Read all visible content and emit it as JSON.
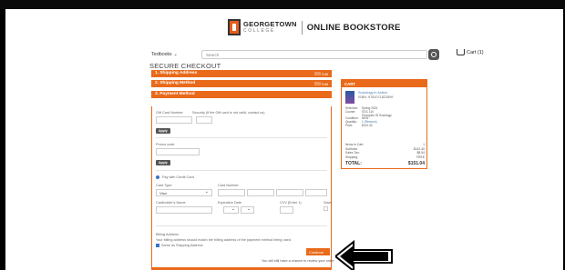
{
  "browser": {
    "left": "",
    "right": ""
  },
  "brand": {
    "name": "GEORGETOWN",
    "subname": "COLLEGE",
    "store": "ONLINE BOOKSTORE"
  },
  "nav": {
    "textbooks": "Textbooks",
    "search_placeholder": "Search",
    "cart": "Cart (1)"
  },
  "page_title": "SECURE CHECKOUT",
  "steps": [
    {
      "label": "1. Shipping Address",
      "edit": "Edit"
    },
    {
      "label": "2. Shipping Method",
      "edit": "Edit"
    },
    {
      "label": "3. Payment Method"
    }
  ],
  "payment": {
    "gift_card_label": "Gift Card Number",
    "gift_card_note": "Security (If the Gift card is not valid, contact us)",
    "apply1": "Apply",
    "promo_label": "Promo code",
    "apply2": "Apply",
    "pay_with": "Pay with Credit Card",
    "card_type_label": "Card Type",
    "card_type_value": "Visa",
    "card_number_label": "Card Number",
    "cardholder_label": "Cardholder's Name",
    "exp_label": "Expiration Date",
    "cvv_label": "CVV (Enter 1)",
    "save_label": "Save",
    "billing_title": "Billing Address",
    "billing_text": "Your billing address should match the billing address of the payment method being used.",
    "same_as_shipping": "Same as Shipping Address",
    "continue": "Continue",
    "note": "You will still have a chance to review your order"
  },
  "cart": {
    "header": "CART",
    "item_title": "Sociology in Action",
    "item_isbn": "ISBN: 9781071822899",
    "meta": [
      {
        "k": "Selection:",
        "v": "Spring 2024"
      },
      {
        "k": "Course:",
        "v": "SOC 110"
      },
      {
        "k": "",
        "v": "Principles Of Sociology"
      },
      {
        "k": "Condition:",
        "v": "NEW"
      },
      {
        "k": "Quantity:",
        "v": "1 (Remove)"
      },
      {
        "k": "Price:",
        "v": "$142.40"
      }
    ],
    "items_label": "Items in Cart:",
    "items_count": "1",
    "subtotal_label": "Subtotal:",
    "subtotal": "$142.40",
    "tax_label": "Sales Tax:",
    "tax": "$8.54",
    "shipping_label": "Shipping:",
    "shipping": "FREE",
    "total_label": "TOTAL:",
    "total": "$151.04"
  },
  "colors": {
    "accent": "#e96a1b",
    "link": "#4a7ab7",
    "radio": "#3b73c4"
  },
  "icons": [
    "search-icon",
    "cart-icon",
    "chevron-down-icon",
    "arrow-icon"
  ]
}
